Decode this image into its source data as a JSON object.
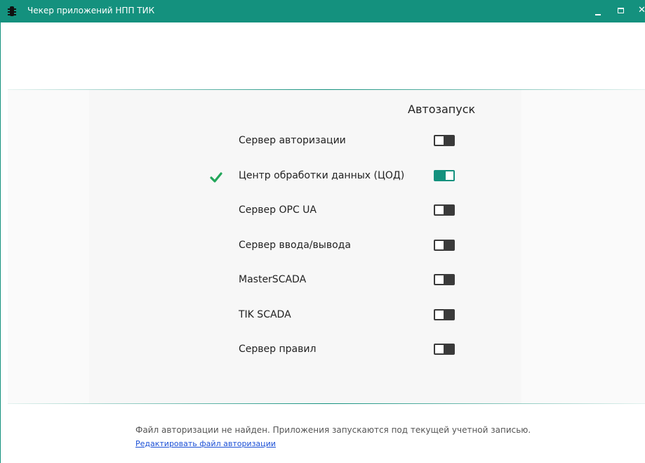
{
  "window": {
    "title": "Чекер приложений НПП ТИК",
    "accent_color": "#14917e",
    "icons": {
      "app": "beetle-icon",
      "minimize": "minimize-icon",
      "maximize": "maximize-icon",
      "close": "close-icon"
    },
    "close_glyph": "✕"
  },
  "table": {
    "column_header": "Автозапуск",
    "rows": [
      {
        "label": "Сервер авторизации",
        "checked": false,
        "autostart": false
      },
      {
        "label": "Центр обработки данных (ЦОД)",
        "checked": true,
        "autostart": true
      },
      {
        "label": "Сервер OPC UA",
        "checked": false,
        "autostart": false
      },
      {
        "label": "Сервер ввода/вывода",
        "checked": false,
        "autostart": false
      },
      {
        "label": "MasterSCADA",
        "checked": false,
        "autostart": false
      },
      {
        "label": "TIK SCADA",
        "checked": false,
        "autostart": false
      },
      {
        "label": "Сервер правил",
        "checked": false,
        "autostart": false
      }
    ]
  },
  "footer": {
    "message": "Файл авторизации не найден. Приложения запускаются под текущей учетной записью.",
    "link": "Редактировать файл авторизации"
  }
}
